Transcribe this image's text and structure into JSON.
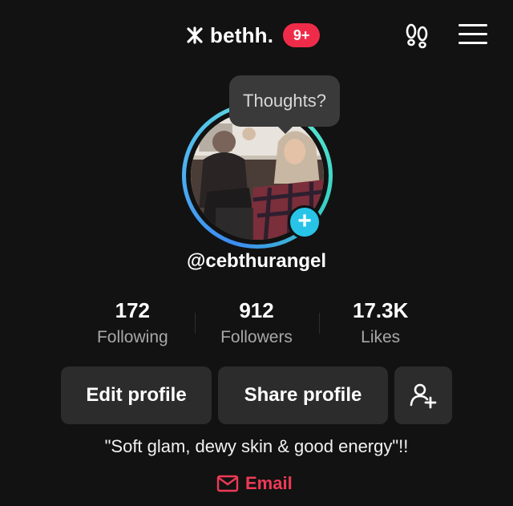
{
  "header": {
    "username": "bethh.",
    "notification_badge": "9+",
    "brand_icon": "tiktok-kaka-icon",
    "footprints_icon": "footprints-icon",
    "menu_icon": "hamburger-menu-icon"
  },
  "profile": {
    "thoughts_prompt": "Thoughts?",
    "handle": "@cebthurangel",
    "add_icon": "plus-icon"
  },
  "stats": [
    {
      "value": "172",
      "label": "Following"
    },
    {
      "value": "912",
      "label": "Followers"
    },
    {
      "value": "17.3K",
      "label": "Likes"
    }
  ],
  "actions": {
    "edit_profile": "Edit profile",
    "share_profile": "Share profile",
    "add_friends_icon": "add-user-icon"
  },
  "bio": {
    "text": "\"Soft glam, dewy skin & good energy\"!!",
    "email_label": "Email",
    "email_icon": "mail-icon"
  },
  "colors": {
    "background": "#121212",
    "badge": "#ee2c4a",
    "email": "#ee3a56",
    "button": "#2c2c2c",
    "add_story": "#27c4e8",
    "ring_start": "#3d8bf2",
    "ring_end": "#5ee6d6"
  }
}
